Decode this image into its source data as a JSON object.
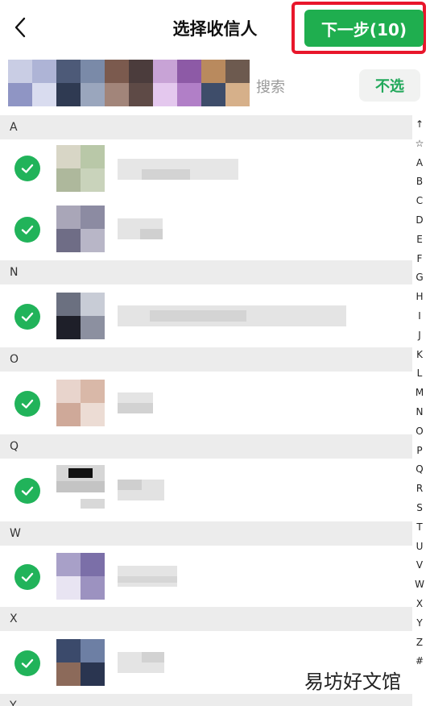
{
  "header": {
    "title": "选择收信人",
    "next_button": "下一步(10)"
  },
  "selected_strip": {
    "search_hint": "搜索",
    "deselect_button": "不选"
  },
  "sections": [
    {
      "letter": "A",
      "rows": 2
    },
    {
      "letter": "N",
      "rows": 1
    },
    {
      "letter": "O",
      "rows": 1
    },
    {
      "letter": "Q",
      "rows": 1
    },
    {
      "letter": "W",
      "rows": 1
    },
    {
      "letter": "X",
      "rows": 1
    },
    {
      "letter": "Y",
      "rows": 0
    }
  ],
  "index": [
    "↑",
    "☆",
    "A",
    "B",
    "C",
    "D",
    "E",
    "F",
    "G",
    "H",
    "I",
    "J",
    "K",
    "L",
    "M",
    "N",
    "O",
    "P",
    "Q",
    "R",
    "S",
    "T",
    "U",
    "V",
    "W",
    "X",
    "Y",
    "Z",
    "#"
  ],
  "watermark": "易坊好文馆",
  "colors": {
    "accent_green": "#1fae4f",
    "highlight_red": "#e8162b",
    "section_bg": "#ececec"
  }
}
